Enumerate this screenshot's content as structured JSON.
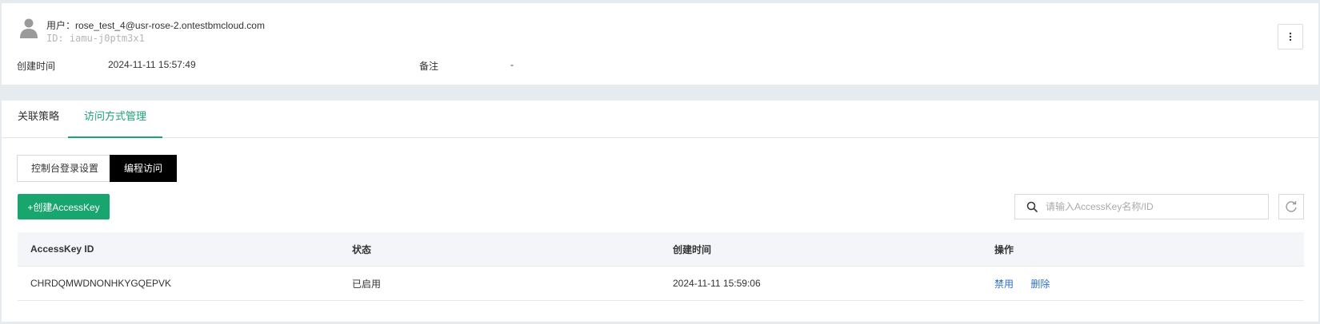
{
  "user": {
    "name": "用户：rose_test_4@usr-rose-2.ontestbmcloud.com",
    "id": "ID: iamu-j0ptm3x1",
    "created_label": "创建时间",
    "created_value": "2024-11-11 15:57:49",
    "note_label": "备注",
    "note_value": "-"
  },
  "tabs": [
    {
      "label": "关联策略"
    },
    {
      "label": "访问方式管理"
    }
  ],
  "segments": [
    {
      "label": "控制台登录设置"
    },
    {
      "label": "编程访问"
    }
  ],
  "actions": {
    "create_label": "+创建AccessKey",
    "search_placeholder": "请输入AccessKey名称/ID"
  },
  "table": {
    "headers": [
      "AccessKey ID",
      "状态",
      "创建时间",
      "操作"
    ],
    "rows": [
      {
        "id": "CHRDQMWDNONHKYGQEPVK",
        "status": "已启用",
        "created": "2024-11-11 15:59:06",
        "op_disable": "禁用",
        "op_delete": "删除"
      }
    ]
  },
  "colors": {
    "accent": "#19a66e",
    "link": "#2d6fc8",
    "active_tab": "#1aa37a"
  }
}
